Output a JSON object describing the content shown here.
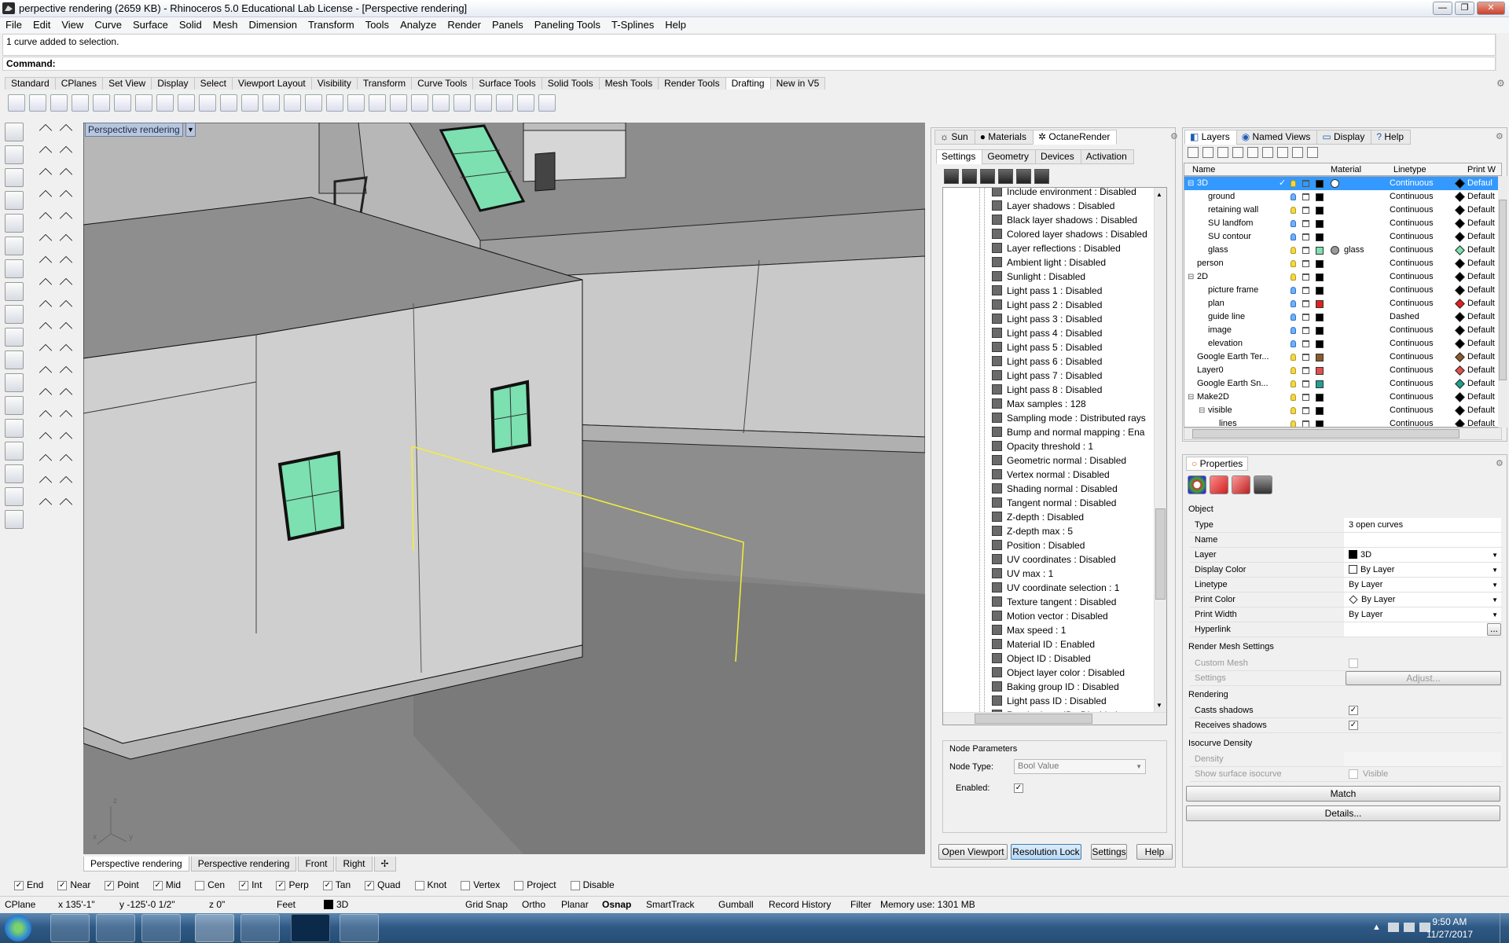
{
  "window": {
    "title": "perpective rendering (2659 KB) - Rhinoceros 5.0 Educational Lab License - [Perspective rendering]",
    "btn_min": "—",
    "btn_max": "❐",
    "btn_close": "✕"
  },
  "menu": [
    "File",
    "Edit",
    "View",
    "Curve",
    "Surface",
    "Solid",
    "Mesh",
    "Dimension",
    "Transform",
    "Tools",
    "Analyze",
    "Render",
    "Panels",
    "Paneling Tools",
    "T-Splines",
    "Help"
  ],
  "command": {
    "history": "1 curve added to selection.",
    "prompt": "Command:"
  },
  "toolbar_tabs": [
    "Standard",
    "CPlanes",
    "Set View",
    "Display",
    "Select",
    "Viewport Layout",
    "Visibility",
    "Transform",
    "Curve Tools",
    "Surface Tools",
    "Solid Tools",
    "Mesh Tools",
    "Render Tools",
    "Drafting",
    "New in V5"
  ],
  "toolbar_active": "Drafting",
  "viewport": {
    "label": "Perspective rendering",
    "axis_z": "z",
    "axis_x": "x",
    "axis_y": "y"
  },
  "viewport_tabs": [
    "Perspective rendering",
    "Perspective rendering",
    "Front",
    "Right"
  ],
  "viewport_tab_add": "✢",
  "octane": {
    "top_tabs": [
      "Sun",
      "Materials",
      "OctaneRender"
    ],
    "sub_tabs": [
      "Settings",
      "Geometry",
      "Devices",
      "Activation"
    ],
    "tree_items": [
      "Include environment : Disabled",
      "Layer shadows : Disabled",
      "Black layer shadows : Disabled",
      "Colored layer shadows : Disabled",
      "Layer reflections : Disabled",
      "Ambient light : Disabled",
      "Sunlight : Disabled",
      "Light pass 1 : Disabled",
      "Light pass 2 : Disabled",
      "Light pass 3 : Disabled",
      "Light pass 4 : Disabled",
      "Light pass 5 : Disabled",
      "Light pass 6 : Disabled",
      "Light pass 7 : Disabled",
      "Light pass 8 : Disabled",
      "Max samples : 128",
      "Sampling mode : Distributed rays",
      "Bump and normal mapping : Ena",
      "Opacity threshold : 1",
      "Geometric normal : Disabled",
      "Vertex normal : Disabled",
      "Shading normal : Disabled",
      "Tangent normal : Disabled",
      "Z-depth : Disabled",
      "Z-depth max : 5",
      "Position : Disabled",
      "UV coordinates : Disabled",
      "UV max : 1",
      "UV coordinate selection : 1",
      "Texture tangent : Disabled",
      "Motion vector : Disabled",
      "Max speed : 1",
      "Material ID : Enabled",
      "Object ID : Disabled",
      "Object layer color : Disabled",
      "Baking group ID : Disabled",
      "Light pass ID : Disabled",
      "Render layer ID : Disabled"
    ],
    "node_params_title": "Node Parameters",
    "node_type_label": "Node Type:",
    "node_type_value": "Bool Value",
    "enabled_label": "Enabled:",
    "buttons": [
      "Open Viewport",
      "Resolution Lock",
      "Settings",
      "Help"
    ]
  },
  "layers_panel": {
    "tabs": [
      "Layers",
      "Named Views",
      "Display",
      "Help"
    ],
    "columns": [
      "Name",
      "Material",
      "Linetype",
      "Print W"
    ],
    "rows": [
      {
        "name": "3D",
        "indent": 1,
        "expander": "⊟",
        "sel": true,
        "color": "#000000",
        "material": "",
        "linetype": "Continuous",
        "print": "Defaul",
        "pcolor": "#000000",
        "bulb": "yellow"
      },
      {
        "name": "ground",
        "indent": 2,
        "color": "#000000",
        "material": "",
        "linetype": "Continuous",
        "print": "Default",
        "pcolor": "#000000",
        "bulb": "blue"
      },
      {
        "name": "retaining wall",
        "indent": 2,
        "color": "#000000",
        "material": "",
        "linetype": "Continuous",
        "print": "Default",
        "pcolor": "#000000",
        "bulb": "yellow"
      },
      {
        "name": "SU landfom",
        "indent": 2,
        "color": "#000000",
        "material": "",
        "linetype": "Continuous",
        "print": "Default",
        "pcolor": "#000000",
        "bulb": "blue"
      },
      {
        "name": "SU contour",
        "indent": 2,
        "color": "#000000",
        "material": "",
        "linetype": "Continuous",
        "print": "Default",
        "pcolor": "#000000",
        "bulb": "blue"
      },
      {
        "name": "glass",
        "indent": 2,
        "color": "#7fe0b0",
        "material": "glass",
        "linetype": "Continuous",
        "print": "Default",
        "pcolor": "#7fe0b0",
        "bulb": "yellow"
      },
      {
        "name": "person",
        "indent": 1,
        "color": "#000000",
        "material": "",
        "linetype": "Continuous",
        "print": "Default",
        "pcolor": "#000000",
        "bulb": "yellow"
      },
      {
        "name": "2D",
        "indent": 1,
        "expander": "⊟",
        "color": "#000000",
        "material": "",
        "linetype": "Continuous",
        "print": "Default",
        "pcolor": "#000000",
        "bulb": "yellow"
      },
      {
        "name": "picture frame",
        "indent": 2,
        "color": "#000000",
        "material": "",
        "linetype": "Continuous",
        "print": "Default",
        "pcolor": "#000000",
        "bulb": "blue"
      },
      {
        "name": "plan",
        "indent": 2,
        "color": "#e02020",
        "material": "",
        "linetype": "Continuous",
        "print": "Default",
        "pcolor": "#e02020",
        "bulb": "blue"
      },
      {
        "name": "guide line",
        "indent": 2,
        "color": "#000000",
        "material": "",
        "linetype": "Dashed",
        "print": "Default",
        "pcolor": "#000000",
        "bulb": "blue"
      },
      {
        "name": "image",
        "indent": 2,
        "color": "#000000",
        "material": "",
        "linetype": "Continuous",
        "print": "Default",
        "pcolor": "#000000",
        "bulb": "blue"
      },
      {
        "name": "elevation",
        "indent": 2,
        "color": "#000000",
        "material": "",
        "linetype": "Continuous",
        "print": "Default",
        "pcolor": "#000000",
        "bulb": "blue"
      },
      {
        "name": "Google Earth Ter...",
        "indent": 1,
        "color": "#8b5a2b",
        "material": "",
        "linetype": "Continuous",
        "print": "Default",
        "pcolor": "#8b5a2b",
        "bulb": "yellow"
      },
      {
        "name": "Layer0",
        "indent": 1,
        "color": "#e05050",
        "material": "",
        "linetype": "Continuous",
        "print": "Default",
        "pcolor": "#e05050",
        "bulb": "yellow"
      },
      {
        "name": "Google Earth Sn...",
        "indent": 1,
        "color": "#20a090",
        "material": "",
        "linetype": "Continuous",
        "print": "Default",
        "pcolor": "#20a090",
        "bulb": "yellow"
      },
      {
        "name": "Make2D",
        "indent": 1,
        "expander": "⊟",
        "color": "#000000",
        "material": "",
        "linetype": "Continuous",
        "print": "Default",
        "pcolor": "#000000",
        "bulb": "yellow"
      },
      {
        "name": "visible",
        "indent": 2,
        "expander": "⊟",
        "color": "#000000",
        "material": "",
        "linetype": "Continuous",
        "print": "Default",
        "pcolor": "#000000",
        "bulb": "yellow"
      },
      {
        "name": "lines",
        "indent": 3,
        "color": "#000000",
        "material": "",
        "linetype": "Continuous",
        "print": "Default",
        "pcolor": "#000000",
        "bulb": "yellow"
      }
    ]
  },
  "properties": {
    "title": "Properties",
    "object_label": "Object",
    "rows": [
      [
        "Type",
        "3 open curves"
      ],
      [
        "Name",
        ""
      ],
      [
        "Layer",
        "3D"
      ],
      [
        "Display Color",
        "By Layer"
      ],
      [
        "Linetype",
        "By Layer"
      ],
      [
        "Print Color",
        "By Layer"
      ],
      [
        "Print Width",
        "By Layer"
      ],
      [
        "Hyperlink",
        ""
      ]
    ],
    "render_mesh": "Render Mesh Settings",
    "custom_mesh": "Custom Mesh",
    "settings": "Settings",
    "adjust": "Adjust...",
    "rendering": "Rendering",
    "casts": "Casts shadows",
    "receives": "Receives shadows",
    "isocurve": "Isocurve Density",
    "density": "Density",
    "show_iso": "Show surface isocurve",
    "visible": "Visible",
    "match": "Match",
    "details": "Details...",
    "hyperlink_btn": "..."
  },
  "osnaps": [
    [
      "End",
      true
    ],
    [
      "Near",
      true
    ],
    [
      "Point",
      true
    ],
    [
      "Mid",
      true
    ],
    [
      "Cen",
      false
    ],
    [
      "Int",
      true
    ],
    [
      "Perp",
      true
    ],
    [
      "Tan",
      true
    ],
    [
      "Quad",
      true
    ],
    [
      "Knot",
      false
    ],
    [
      "Vertex",
      false
    ],
    [
      "Project",
      false
    ],
    [
      "Disable",
      false
    ]
  ],
  "status": {
    "cplane": "CPlane",
    "x": "x 135'-1\"",
    "y": "y -125'-0 1/2\"",
    "z": "z 0\"",
    "units": "Feet",
    "layer": "3D",
    "items": [
      "Grid Snap",
      "Ortho",
      "Planar",
      "Osnap",
      "SmartTrack",
      "Gumball",
      "Record History",
      "Filter"
    ],
    "memory": "Memory use: 1301 MB"
  },
  "clock": {
    "time": "9:50 AM",
    "date": "11/27/2017"
  }
}
